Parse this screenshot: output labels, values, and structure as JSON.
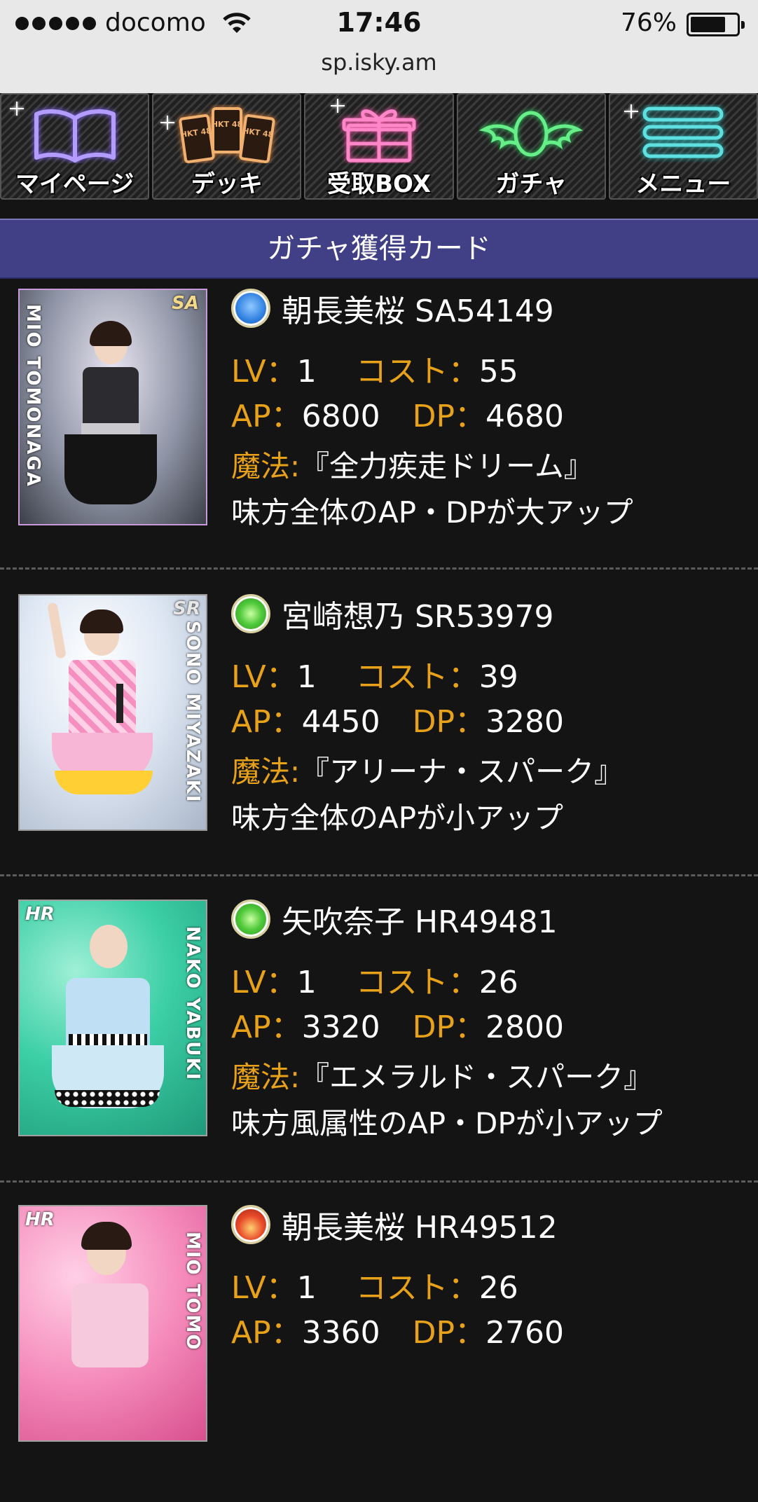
{
  "status_bar": {
    "carrier": "docomo",
    "time": "17:46",
    "battery_percent": "76%",
    "battery_level": 0.76
  },
  "browser": {
    "url": "sp.isky.am"
  },
  "nav": {
    "items": [
      {
        "label": "マイページ",
        "icon": "book-icon",
        "color": "#b49cff"
      },
      {
        "label": "デッキ",
        "icon": "cards-icon",
        "color": "#f0b070",
        "card_text": "HKT 48"
      },
      {
        "label": "受取BOX",
        "icon": "gift-icon",
        "color": "#ff86c8"
      },
      {
        "label": "ガチャ",
        "icon": "winged-egg-icon",
        "color": "#66ee88"
      },
      {
        "label": "メニュー",
        "icon": "menu-icon",
        "color": "#5fe0e0"
      }
    ]
  },
  "section": {
    "title": "ガチャ獲得カード"
  },
  "labels": {
    "lv": "LV：",
    "cost": "コスト：",
    "ap": "AP：",
    "dp": "DP：",
    "magic": "魔法:"
  },
  "cards": [
    {
      "attribute": "water",
      "attribute_color": "#2f7fe0",
      "name": "朝長美桜 SA54149",
      "rarity_badge": "SA",
      "nameplate": "MIO TOMONAGA",
      "lv": "1",
      "cost": "55",
      "ap": "6800",
      "dp": "4680",
      "magic": "『全力疾走ドリーム』",
      "effect": "味方全体のAP・DPが大アップ"
    },
    {
      "attribute": "wind",
      "attribute_color": "#3fbf3f",
      "name": "宮崎想乃 SR53979",
      "rarity_badge": "SR",
      "nameplate": "SONO MIYAZAKI",
      "lv": "1",
      "cost": "39",
      "ap": "4450",
      "dp": "3280",
      "magic": "『アリーナ・スパーク』",
      "effect": "味方全体のAPが小アップ"
    },
    {
      "attribute": "wind",
      "attribute_color": "#3fbf3f",
      "name": "矢吹奈子 HR49481",
      "rarity_badge": "HR",
      "nameplate": "NAKO YABUKI",
      "lv": "1",
      "cost": "26",
      "ap": "3320",
      "dp": "2800",
      "magic": "『エメラルド・スパーク』",
      "effect": "味方風属性のAP・DPが小アップ"
    },
    {
      "attribute": "fire",
      "attribute_color": "#d8302a",
      "name": "朝長美桜 HR49512",
      "rarity_badge": "HR",
      "nameplate": "MIO TOMO",
      "lv": "1",
      "cost": "26",
      "ap": "3360",
      "dp": "2760",
      "magic": "",
      "effect": ""
    }
  ]
}
